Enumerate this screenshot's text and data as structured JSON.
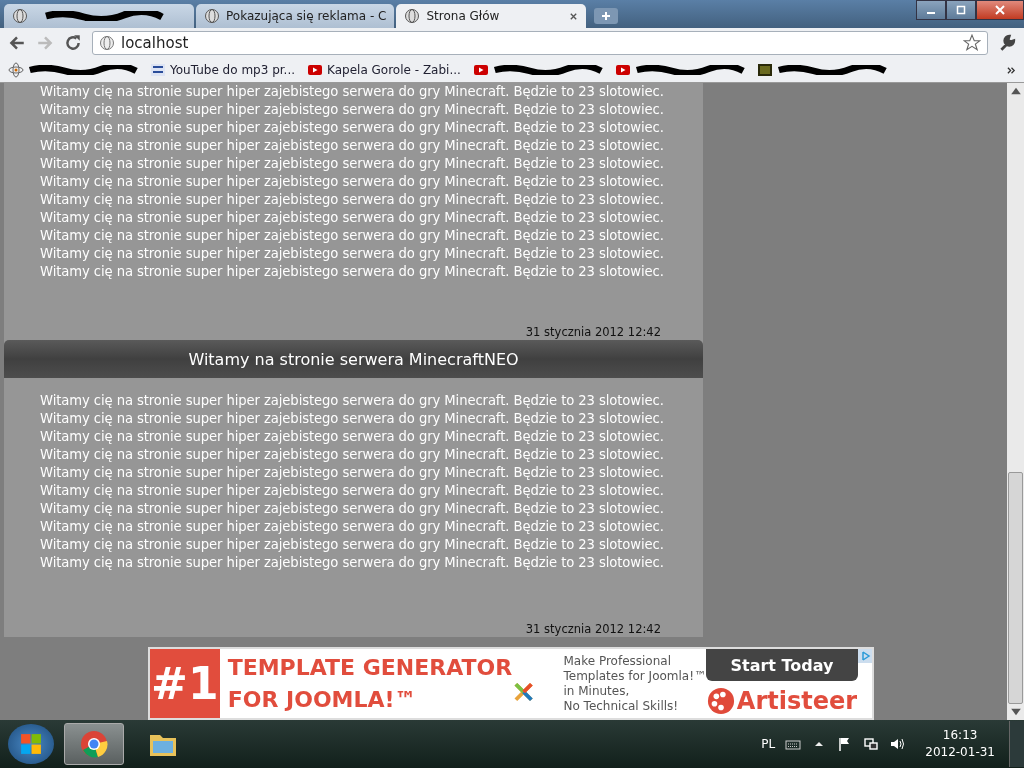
{
  "tabs": [
    {
      "selected": false
    },
    {
      "title": "Pokazująca się reklama - C",
      "selected": false
    },
    {
      "title": "Strona Głów",
      "selected": true
    }
  ],
  "address": "localhost",
  "bookmarks": [
    {
      "kind": "atom"
    },
    {
      "label": "YouTube do mp3 pr...",
      "kind": "yt-mp3"
    },
    {
      "label": "Kapela Gorole - Zabi...",
      "kind": "youtube"
    },
    {
      "kind": "youtube"
    },
    {
      "kind": "youtube"
    },
    {
      "kind": "dark"
    }
  ],
  "posts": [
    {
      "lines": [
        "Witamy cię na stronie super hiper zajebistego serwera do gry Minecraft. Będzie to 23 slotowiec.",
        "Witamy cię na stronie super hiper zajebistego serwera do gry Minecraft. Będzie to 23 slotowiec.",
        "Witamy cię na stronie super hiper zajebistego serwera do gry Minecraft. Będzie to 23 slotowiec.",
        "Witamy cię na stronie super hiper zajebistego serwera do gry Minecraft. Będzie to 23 slotowiec.",
        "Witamy cię na stronie super hiper zajebistego serwera do gry Minecraft. Będzie to 23 slotowiec.",
        "Witamy cię na stronie super hiper zajebistego serwera do gry Minecraft. Będzie to 23 slotowiec.",
        "Witamy cię na stronie super hiper zajebistego serwera do gry Minecraft. Będzie to 23 slotowiec.",
        "Witamy cię na stronie super hiper zajebistego serwera do gry Minecraft. Będzie to 23 slotowiec.",
        "Witamy cię na stronie super hiper zajebistego serwera do gry Minecraft. Będzie to 23 slotowiec.",
        "Witamy cię na stronie super hiper zajebistego serwera do gry Minecraft. Będzie to 23 slotowiec.",
        "Witamy cię na stronie super hiper zajebistego serwera do gry Minecraft. Będzie to 23 slotowiec."
      ],
      "date": "31 stycznia 2012 12:42"
    },
    {
      "title": "Witamy na stronie serwera MinecraftNEO",
      "lines": [
        "Witamy cię na stronie super hiper zajebistego serwera do gry Minecraft. Będzie to 23 slotowiec.",
        "Witamy cię na stronie super hiper zajebistego serwera do gry Minecraft. Będzie to 23 slotowiec.",
        "Witamy cię na stronie super hiper zajebistego serwera do gry Minecraft. Będzie to 23 slotowiec.",
        "Witamy cię na stronie super hiper zajebistego serwera do gry Minecraft. Będzie to 23 slotowiec.",
        "Witamy cię na stronie super hiper zajebistego serwera do gry Minecraft. Będzie to 23 slotowiec.",
        "Witamy cię na stronie super hiper zajebistego serwera do gry Minecraft. Będzie to 23 slotowiec.",
        "Witamy cię na stronie super hiper zajebistego serwera do gry Minecraft. Będzie to 23 slotowiec.",
        "Witamy cię na stronie super hiper zajebistego serwera do gry Minecraft. Będzie to 23 slotowiec.",
        "Witamy cię na stronie super hiper zajebistego serwera do gry Minecraft. Będzie to 23 slotowiec.",
        "Witamy cię na stronie super hiper zajebistego serwera do gry Minecraft. Będzie to 23 slotowiec."
      ],
      "date": "31 stycznia 2012 12:42"
    }
  ],
  "ad": {
    "rank": "#1",
    "headline": [
      "TEMPLATE GENERATOR",
      "FOR JOOMLA!™"
    ],
    "body": [
      "Make Professional",
      "Templates for Joomla!™",
      "in Minutes,",
      "No Technical Skills!"
    ],
    "cta": "Start Today",
    "brand": "Artisteer"
  },
  "taskbar": {
    "language": "PL",
    "time": "16:13",
    "date": "2012-01-31"
  }
}
